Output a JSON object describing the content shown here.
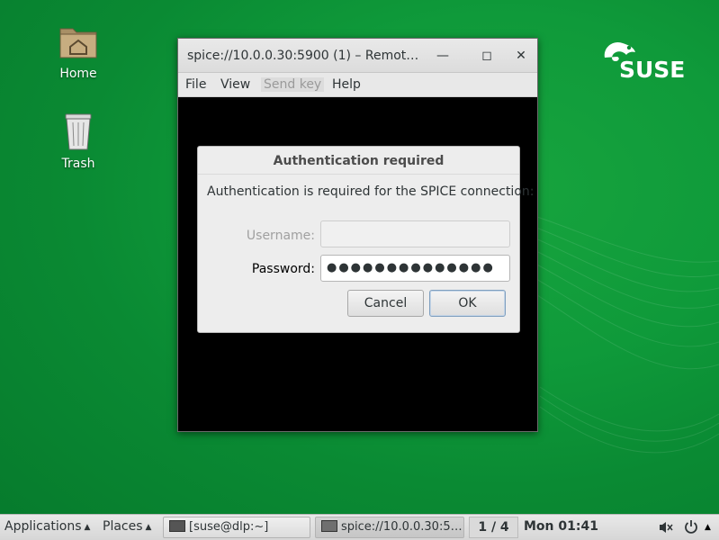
{
  "desktop": {
    "icons": [
      {
        "label": "Home"
      },
      {
        "label": "Trash"
      }
    ],
    "brand": "SUSE"
  },
  "window": {
    "title": "spice://10.0.0.30:5900 (1) – Remot…",
    "controls": {
      "minimize": "—",
      "maximize": "◻",
      "close": "✕"
    },
    "menu": {
      "file": "File",
      "view": "View",
      "send_key": "Send key",
      "help": "Help"
    }
  },
  "dialog": {
    "title": "Authentication required",
    "message": "Authentication is required for the SPICE connection:",
    "username_label": "Username:",
    "username_value": "",
    "password_label": "Password:",
    "password_value": "●●●●●●●●●●●●●●",
    "cancel_label": "Cancel",
    "ok_label": "OK"
  },
  "taskbar": {
    "applications": "Applications",
    "places": "Places",
    "tasks": [
      {
        "label": "[suse@dlp:~]"
      },
      {
        "label": "spice://10.0.0.30:5…"
      }
    ],
    "pager": "1 / 4",
    "clock": "Mon 01:41"
  },
  "colors": {
    "desktop_green": "#0f9a3a",
    "accent_blue": "#7f9fbf"
  }
}
